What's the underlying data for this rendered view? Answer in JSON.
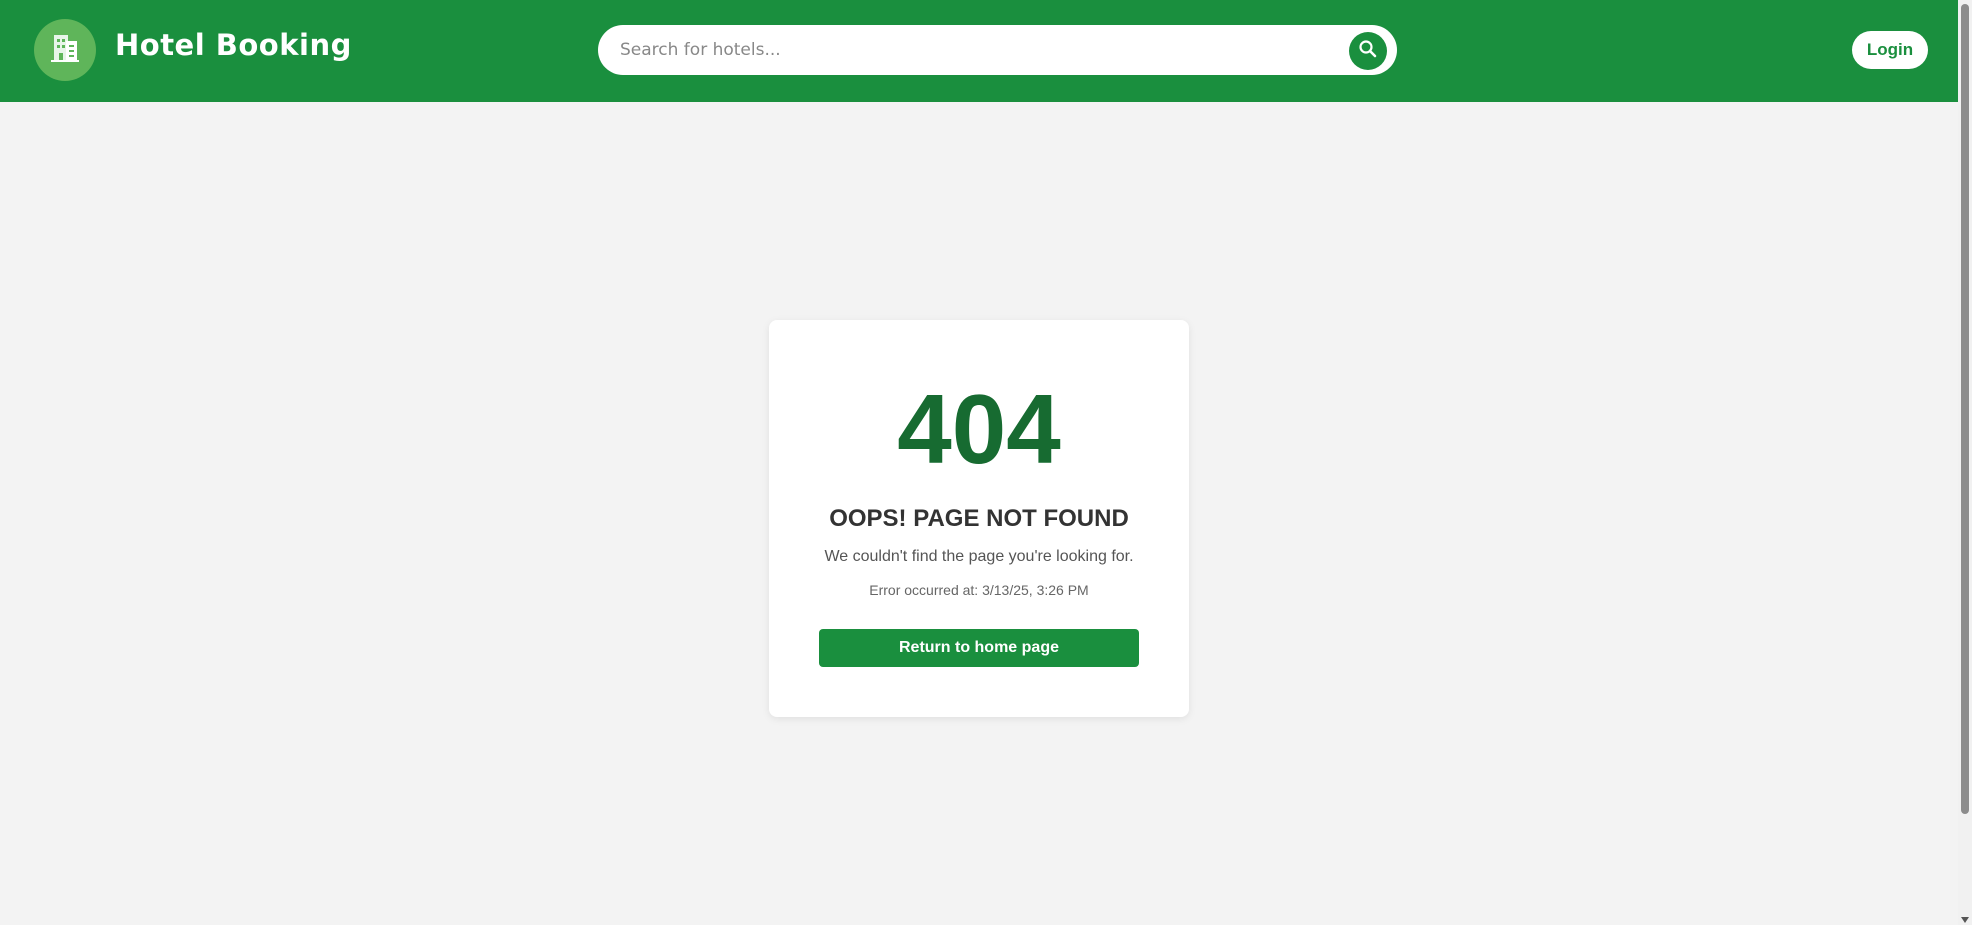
{
  "header": {
    "brand_title": "Hotel Booking",
    "logo_icon": "hotel-building-icon",
    "search": {
      "placeholder": "Search for hotels...",
      "value": "",
      "button_icon": "search-icon"
    },
    "login_label": "Login"
  },
  "error": {
    "code": "404",
    "title": "OOPS! PAGE NOT FOUND",
    "message": "We couldn't find the page you're looking for.",
    "timestamp": "Error occurred at: 3/13/25, 3:26 PM",
    "home_button_label": "Return to home page"
  },
  "colors": {
    "header_bg": "#1a8f3e",
    "logo_bg": "#5fb55a",
    "error_code": "#176b31",
    "page_bg": "#f3f3f3",
    "button_bg": "#1a8f3e"
  }
}
